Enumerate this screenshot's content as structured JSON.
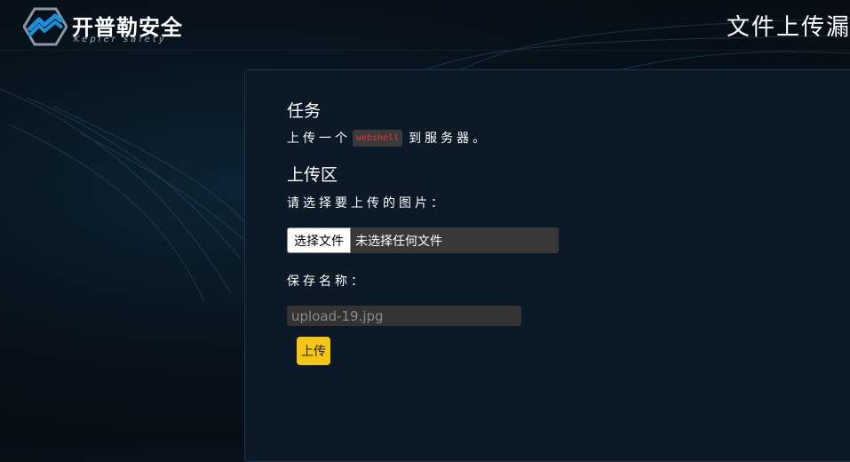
{
  "header": {
    "logo_cn": "开普勒安全",
    "logo_en": "Kepler safety",
    "page_title": "文件上传漏"
  },
  "task": {
    "heading": "任务",
    "text_before": "上传一个",
    "code": "webshell",
    "text_after": "到服务器。"
  },
  "upload": {
    "heading": "上传区",
    "choose_label": "请选择要上传的图片：",
    "file_button_label": "选择文件",
    "file_status": "未选择任何文件",
    "save_name_label": "保存名称：",
    "save_name_placeholder": "upload-19.jpg",
    "submit_label": "上传"
  },
  "colors": {
    "accent": "#f5c518",
    "code_text": "#e8334a",
    "logo_blue": "#1e8fd6"
  }
}
